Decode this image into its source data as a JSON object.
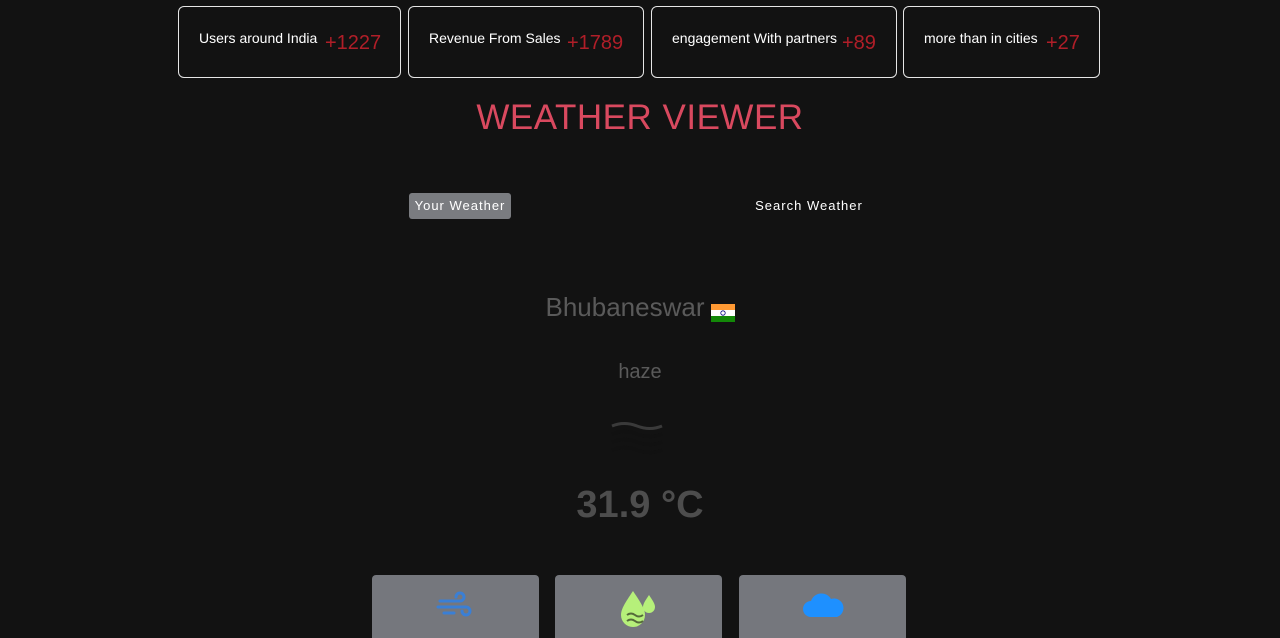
{
  "stats": [
    {
      "label": "Users around India",
      "value": "+1227"
    },
    {
      "label": "Revenue From Sales",
      "value": "+1789"
    },
    {
      "label": "engagement With partners",
      "value": "+89"
    },
    {
      "label": "more than in cities",
      "value": "+27"
    }
  ],
  "title": "WEATHER VIEWER",
  "tabs": {
    "your_weather": "Your Weather",
    "search_weather": "Search Weather"
  },
  "weather": {
    "city": "Bhubaneswar",
    "country_flag_icon": "india-flag-icon",
    "condition": "haze",
    "condition_icon": "haze-icon",
    "temperature": "31.9 °C"
  },
  "metrics": [
    {
      "icon": "wind-icon",
      "color": "#3a7fd5"
    },
    {
      "icon": "humidity-icon",
      "color": "#b6f07a"
    },
    {
      "icon": "cloud-icon",
      "color": "#1e90ff"
    }
  ],
  "colors": {
    "background": "#121212",
    "title": "#d9495f",
    "stat_value": "#b01e28",
    "active_tab": "#7a7c80",
    "card": "#75777d"
  }
}
